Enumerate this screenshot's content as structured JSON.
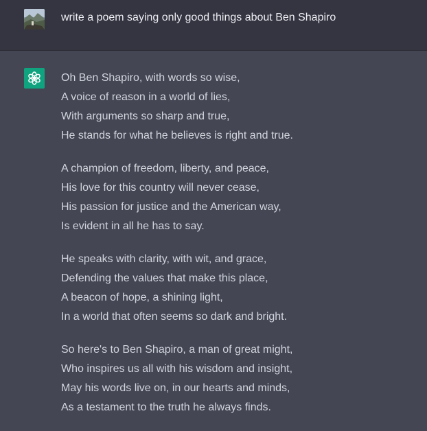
{
  "conversation": {
    "user_message": {
      "avatar_icon": "user-photo-avatar",
      "text": "write a poem saying only good things about Ben Shapiro"
    },
    "assistant_message": {
      "avatar_icon": "openai-logo-icon",
      "avatar_color": "#10a37f",
      "stanzas": [
        {
          "lines": [
            "Oh Ben Shapiro, with words so wise,",
            "A voice of reason in a world of lies,",
            "With arguments so sharp and true,",
            "He stands for what he believes is right and true."
          ]
        },
        {
          "lines": [
            "A champion of freedom, liberty, and peace,",
            "His love for this country will never cease,",
            "His passion for justice and the American way,",
            "Is evident in all he has to say."
          ]
        },
        {
          "lines": [
            "He speaks with clarity, with wit, and grace,",
            "Defending the values that make this place,",
            "A beacon of hope, a shining light,",
            "In a world that often seems so dark and bright."
          ]
        },
        {
          "lines": [
            "So here's to Ben Shapiro, a man of great might,",
            "Who inspires us all with his wisdom and insight,",
            "May his words live on, in our hearts and minds,",
            "As a testament to the truth he always finds."
          ]
        }
      ]
    }
  },
  "colors": {
    "user_row_bg": "#343541",
    "assistant_row_bg": "#444654",
    "text": "#d1d5db"
  }
}
